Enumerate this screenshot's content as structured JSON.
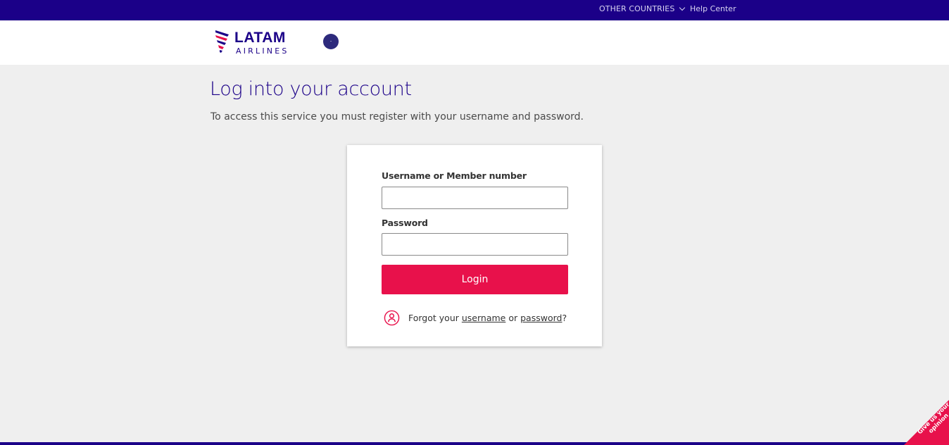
{
  "topbar": {
    "countries_label": "OTHER COUNTRIES",
    "help_label": "Help Center"
  },
  "header": {
    "logo_main": "LATAM",
    "logo_sub": "AIRLINES",
    "partner_logo_icon": "oneworld-logo-icon"
  },
  "page": {
    "title": "Log into your account",
    "subtitle": "To access this service you must register with your username and password."
  },
  "login_form": {
    "username_label": "Username or Member number",
    "username_value": "",
    "password_label": "Password",
    "password_value": "",
    "login_button": "Login",
    "forgot_icon": "user-help-icon",
    "forgot_prefix": "Forgot your",
    "forgot_username_link": "username",
    "forgot_or": "or",
    "forgot_password_link": "password",
    "forgot_suffix": "?"
  },
  "feedback": {
    "label": "Give us your opinion"
  },
  "colors": {
    "brand_indigo": "#1b0088",
    "brand_coral": "#e8114b",
    "page_bg": "#efefef"
  }
}
